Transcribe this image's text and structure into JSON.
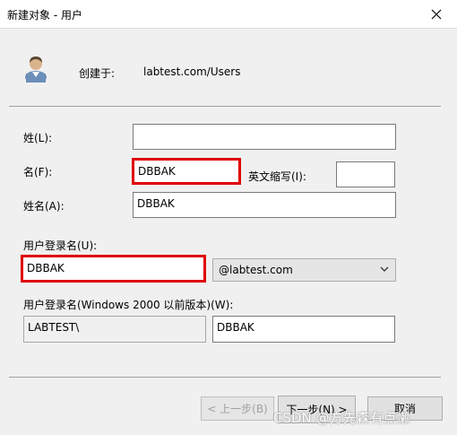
{
  "window": {
    "title": "新建对象 - 用户"
  },
  "header": {
    "create_in_label": "创建于:",
    "create_in_value": "labtest.com/Users"
  },
  "form": {
    "last_name_label": "姓(L):",
    "last_name_value": "",
    "first_name_label": "名(F):",
    "first_name_value": "DBBAK",
    "initials_label": "英文缩写(I):",
    "initials_value": "",
    "full_name_label": "姓名(A):",
    "full_name_value": "DBBAK",
    "logon_name_label": "用户登录名(U):",
    "logon_name_value": "DBBAK",
    "domain_value": "@labtest.com",
    "pre2000_label": "用户登录名(Windows 2000 以前版本)(W):",
    "pre2000_domain": "LABTEST\\",
    "pre2000_name": "DBBAK"
  },
  "buttons": {
    "back": "< 上一步(B)",
    "next": "下一步(N) >",
    "cancel": "取消"
  },
  "watermark": "CSDN @方先森有点懒",
  "colors": {
    "highlight": "#e00000"
  },
  "icons": {
    "user": "user-icon",
    "close": "close-icon",
    "dropdown": "chevron-down-icon"
  }
}
